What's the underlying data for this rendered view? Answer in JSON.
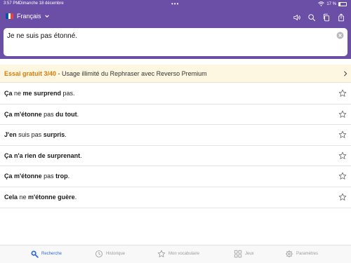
{
  "status_bar": {
    "time": "3:57 PM",
    "date": "Dimanche 18 décembre",
    "dots": "•••",
    "battery_text": "17 %",
    "battery_level": 0.17
  },
  "header": {
    "language": "Français",
    "flag_colors": [
      "#0055a4",
      "#ffffff",
      "#ef4135"
    ],
    "icons": [
      "speaker-icon",
      "search-icon",
      "copy-icon",
      "share-icon"
    ]
  },
  "input": {
    "value": "Je ne suis pas étonné."
  },
  "promo": {
    "strong": "Essai gratuit 3/40",
    "text": " - Usage illimité du Rephraser avec Reverso Premium"
  },
  "results": [
    [
      {
        "t": "Ça",
        "b": true
      },
      {
        "t": " ne ",
        "b": false
      },
      {
        "t": "me surprend",
        "b": true
      },
      {
        "t": " pas.",
        "b": false
      }
    ],
    [
      {
        "t": "Ça m'étonne",
        "b": true
      },
      {
        "t": " pas ",
        "b": false
      },
      {
        "t": "du tout",
        "b": true
      },
      {
        "t": ".",
        "b": false
      }
    ],
    [
      {
        "t": "J'en",
        "b": true
      },
      {
        "t": " suis pas ",
        "b": false
      },
      {
        "t": "surpris",
        "b": true
      },
      {
        "t": ".",
        "b": false
      }
    ],
    [
      {
        "t": "Ça n'a rien de surprenant",
        "b": true
      },
      {
        "t": ".",
        "b": false
      }
    ],
    [
      {
        "t": "Ça m'étonne",
        "b": true
      },
      {
        "t": " pas ",
        "b": false
      },
      {
        "t": "trop",
        "b": true
      },
      {
        "t": ".",
        "b": false
      }
    ],
    [
      {
        "t": "Cela",
        "b": true
      },
      {
        "t": " ne ",
        "b": false
      },
      {
        "t": "m'étonne guère",
        "b": true
      },
      {
        "t": ".",
        "b": false
      }
    ]
  ],
  "tabs": {
    "search": "Recherche",
    "history": "Historique",
    "vocabulary": "Mon vocabulaire",
    "games": "Jeux",
    "settings": "Paramètres"
  },
  "colors": {
    "header_bg": "#6b4ea6",
    "accent": "#2e6ad8",
    "promo_highlight": "#d77c0c"
  }
}
